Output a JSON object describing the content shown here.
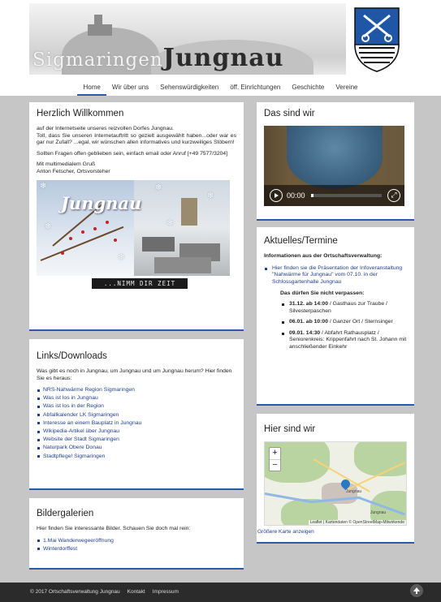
{
  "header": {
    "title_part1": "Sigmaringen",
    "title_part2": "Jungnau"
  },
  "nav": [
    {
      "label": "Home",
      "active": true
    },
    {
      "label": "Wir über uns"
    },
    {
      "label": "Sehenswürdigkeiten"
    },
    {
      "label": "öff. Einrichtungen"
    },
    {
      "label": "Geschichte"
    },
    {
      "label": "Vereine"
    }
  ],
  "welcome": {
    "title": "Herzlich Willkommen",
    "p1": "auf der Internetseite unseres reizvollen Dorfes Jungnau.",
    "p2": "Toll, dass Sie unseren Internetauftritt so gezielt ausgewählt haben...oder war es gar nur Zufall? ...egal, wir wünschen allen informatives und kurzweiliges Stöbern!",
    "p3": "Sollten Fragen offen geblieben sein, einfach email oder Anruf [+49 7577/3204]",
    "greeting": "Mit multimedialem Gruß",
    "signature": "Anton Fetscher, Ortsvorsteher",
    "image_title": "Jungnau",
    "image_slogan": "...NIMM DIR ZEIT"
  },
  "links": {
    "title": "Links/Downloads",
    "intro": "Was gibt es noch in Jungnau, um Jungnau und um Jungnau herum? Hier finden Sie es heraus:",
    "items": [
      "NRS-Nahwärme Region Sigmaringen",
      "Was ist los in Jungnau",
      "Was ist los in der Region",
      "Abfallkalender LK Sigmaringen",
      "Interesse an einem Bauplatz in Jungnau",
      "Wikipedia-Artikel über Jungnau",
      "Website der Stadt Sigmaringen",
      "Naturpark Obere Donau",
      "Stadtpflege! Sigmaringen"
    ]
  },
  "galleries": {
    "title": "Bildergalerien",
    "intro": "Hier finden Sie interessante Bilder. Schauen Sie doch mal rein:",
    "items": [
      "1.Mai Wanderwegeeröffnung",
      "Winterdorffest"
    ]
  },
  "about": {
    "title": "Das sind wir",
    "video_time": "00:00",
    "video_progress": 0.04
  },
  "news": {
    "title": "Aktuelles/Termine",
    "intro": "Informationen aus der Ortschaftsverwaltung:",
    "items": [
      "Hier finden sie die Präsentation der Infoveranstaltung \"Nahwärme für Jungnau\" vom 07.10. in der Schlossgartenhalle Jungnau"
    ],
    "subhead": "Das dürfen Sie nicht verpassen:",
    "events": [
      {
        "date": "31.12. ab 14:00",
        "text": " / Gasthaus zur Traube / Silvesterpaschen"
      },
      {
        "date": "06.01. ab 10:00",
        "text": " / Ganzer Ort / Sternsinger"
      },
      {
        "date": "09.01. 14:30",
        "text": " / Abfahrt Rathausplatz / Seniorenkreis: Krippenfahrt nach St. Johann mit anschließender Einkehr"
      }
    ]
  },
  "location": {
    "title": "Hier sind wir",
    "zoom_in": "+",
    "zoom_out": "−",
    "attribution": "Leaflet | Kartendaten © OpenStreetMap-Mitwirkende",
    "map_label_town": "Jungnau",
    "map_label_south": "Jungnau",
    "larger_map": "Größere Karte anzeigen"
  },
  "footer": {
    "copyright": "© 2017 Ortschaftsverwaltung Jungnau",
    "contact": "Kontakt",
    "imprint": "Impressum"
  }
}
